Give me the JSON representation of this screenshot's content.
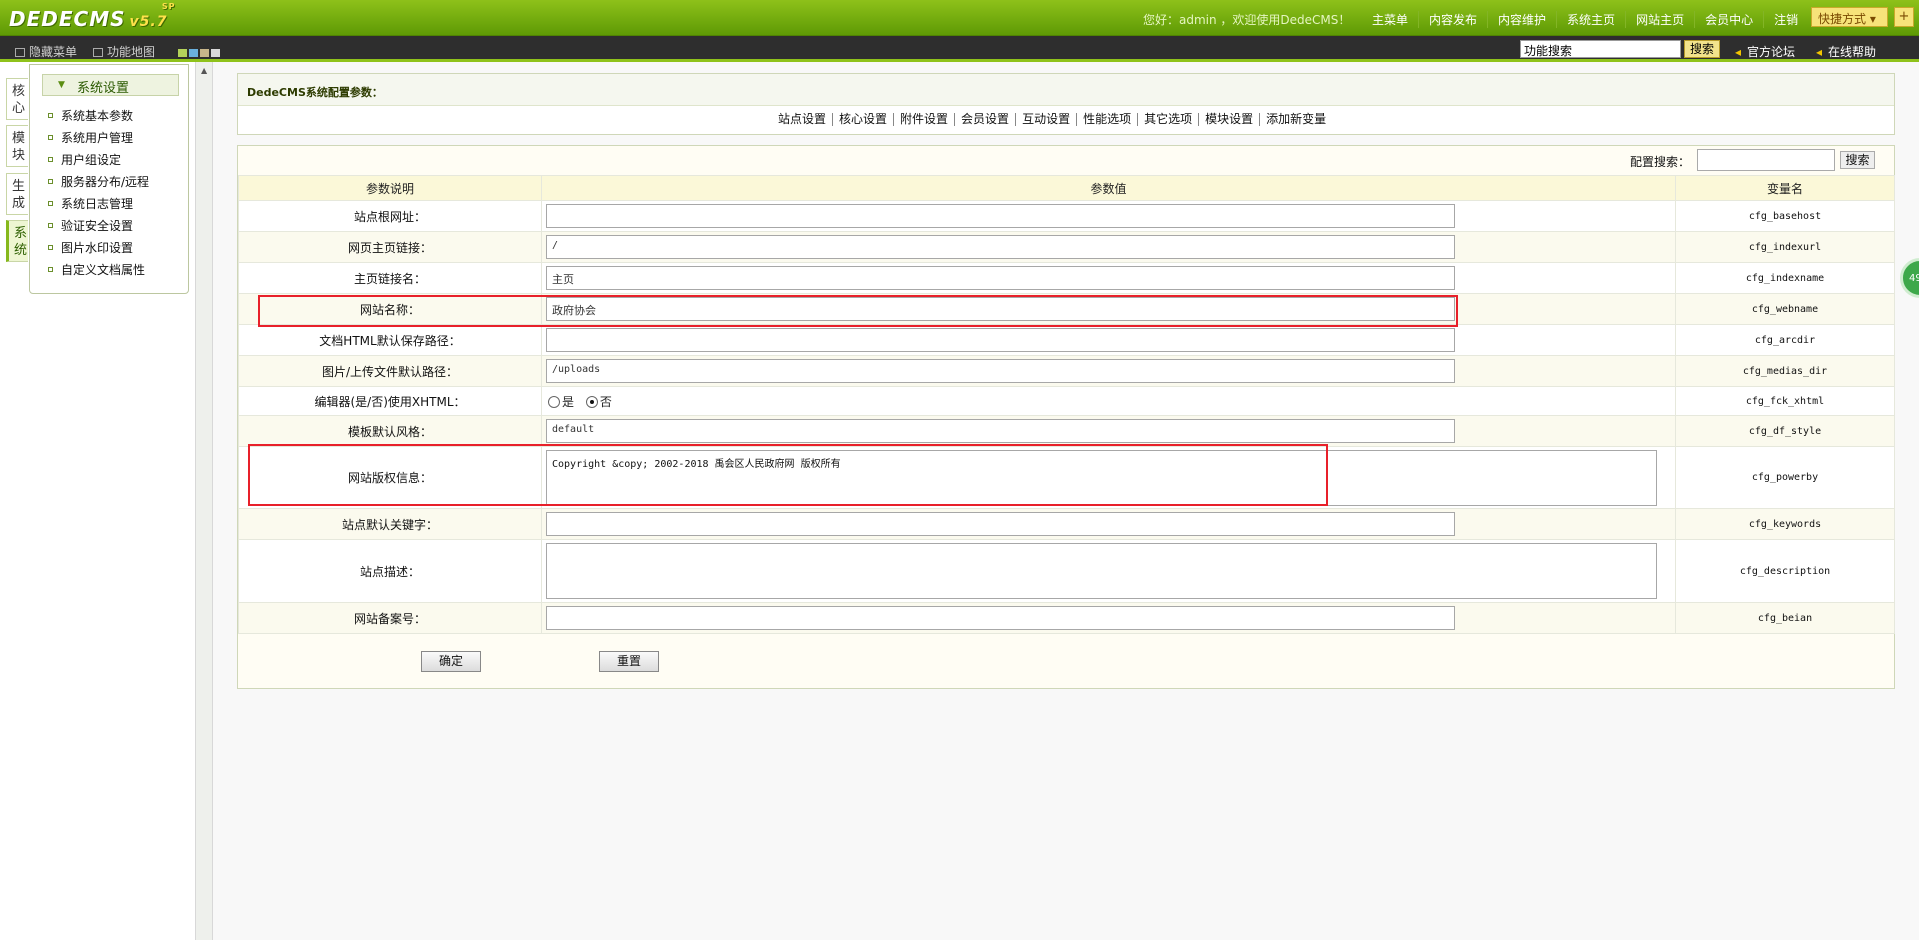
{
  "app": {
    "logo": "DEDECMS",
    "version": "v5.7",
    "version_tag": "SP",
    "welcome": "您好：admin ，欢迎使用DedeCMS！",
    "topnav": [
      "主菜单",
      "内容发布",
      "内容维护",
      "系统主页",
      "网站主页",
      "会员中心",
      "注销"
    ],
    "quick_label": "快捷方式",
    "quick_plus": "+"
  },
  "subbar": {
    "hide_menu": "隐藏菜单",
    "function_map": "功能地图",
    "search_value": "功能搜索",
    "search_button": "搜索",
    "forum_link": "官方论坛",
    "help_link": "在线帮助"
  },
  "left_tabs": [
    {
      "label": "核心",
      "active": false
    },
    {
      "label": "模块",
      "active": false
    },
    {
      "label": "生成",
      "active": false
    },
    {
      "label": "系统",
      "active": true
    }
  ],
  "menu": {
    "title": "系统设置",
    "items": [
      "系统基本参数",
      "系统用户管理",
      "用户组设定",
      "服务器分布/远程",
      "系统日志管理",
      "验证安全设置",
      "图片水印设置",
      "自定义文档属性"
    ]
  },
  "config": {
    "title": "DedeCMS系统配置参数：",
    "tabs": [
      "站点设置",
      "核心设置",
      "附件设置",
      "会员设置",
      "互动设置",
      "性能选项",
      "其它选项",
      "模块设置",
      "添加新变量"
    ],
    "search_label": "配置搜索：",
    "search_button": "搜索",
    "headers": [
      "参数说明",
      "参数值",
      "变量名"
    ],
    "rows": [
      {
        "label": "站点根网址：",
        "value": "",
        "var": "cfg_basehost"
      },
      {
        "label": "网页主页链接：",
        "value": "/",
        "var": "cfg_indexurl"
      },
      {
        "label": "主页链接名：",
        "value": "主页",
        "var": "cfg_indexname"
      },
      {
        "label": "网站名称：",
        "value": "政府协会",
        "var": "cfg_webname"
      },
      {
        "label": "文档HTML默认保存路径：",
        "value": "",
        "var": "cfg_arcdir"
      },
      {
        "label": "图片/上传文件默认路径：",
        "value": "/uploads",
        "var": "cfg_medias_dir"
      },
      {
        "label": "编辑器(是/否)使用XHTML：",
        "radio_yes": "是",
        "radio_no": "否",
        "var": "cfg_fck_xhtml"
      },
      {
        "label": "模板默认风格：",
        "value": "default",
        "var": "cfg_df_style"
      },
      {
        "label": "网站版权信息：",
        "value": "Copyright &copy; 2002-2018 禹会区人民政府网 版权所有",
        "var": "cfg_powerby"
      },
      {
        "label": "站点默认关键字：",
        "value": "",
        "var": "cfg_keywords"
      },
      {
        "label": "站点描述：",
        "value": "",
        "var": "cfg_description"
      },
      {
        "label": "网站备案号：",
        "value": "",
        "var": "cfg_beian"
      }
    ],
    "ok_button": "确定",
    "reset_button": "重置"
  },
  "bubble_text": "49",
  "colors": {
    "accent": "#8ec11a",
    "highlight": "#e8202a",
    "header_bg": "#fbf8d8"
  }
}
